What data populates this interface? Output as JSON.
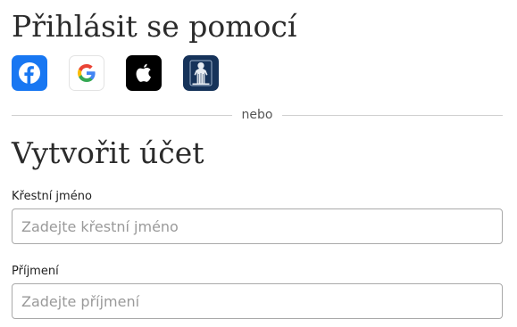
{
  "signin": {
    "title": "Přihlásit se pomocí",
    "providers": [
      {
        "id": "facebook",
        "icon": "facebook-icon",
        "color": "#1877F2"
      },
      {
        "id": "google",
        "icon": "google-icon",
        "color": "#FFFFFF"
      },
      {
        "id": "apple",
        "icon": "apple-icon",
        "color": "#000000"
      },
      {
        "id": "church",
        "icon": "church-logo-icon",
        "color": "#16335A"
      }
    ]
  },
  "divider": {
    "text": "nebo"
  },
  "create_account": {
    "title": "Vytvořit účet",
    "first_name": {
      "label": "Křestní jméno",
      "placeholder": "Zadejte křestní jméno",
      "value": ""
    },
    "last_name": {
      "label": "Příjmení",
      "placeholder": "Zadejte příjmení",
      "value": ""
    }
  }
}
